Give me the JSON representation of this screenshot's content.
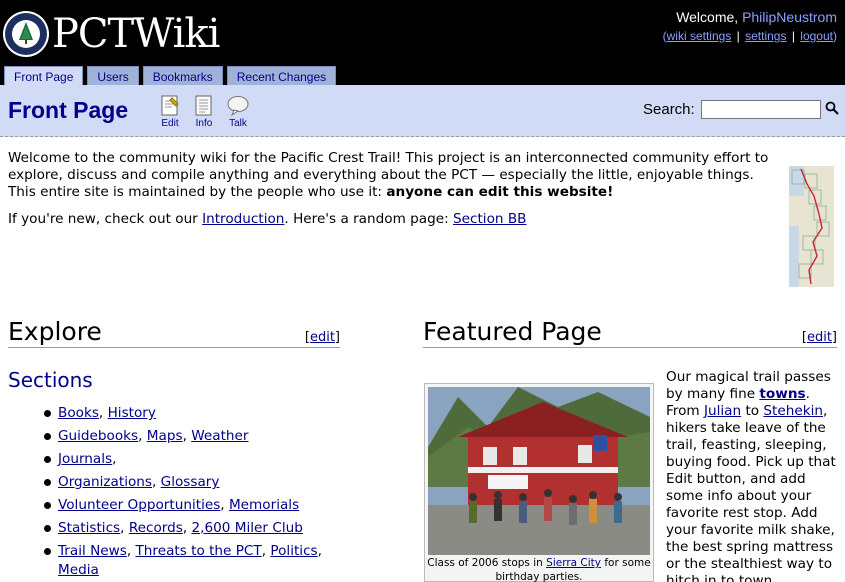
{
  "site": {
    "logo_text": "PCTWiki",
    "badge_text": "Pacific Crest Trail"
  },
  "user": {
    "welcome": "Welcome,",
    "name": "PhilipNeustrom",
    "links": [
      "wiki settings",
      "settings",
      "logout"
    ],
    "open_paren": "(",
    "close_paren": ")",
    "separator": "|"
  },
  "tabs": [
    {
      "label": "Front Page",
      "active": true
    },
    {
      "label": "Users"
    },
    {
      "label": "Bookmarks"
    },
    {
      "label": "Recent Changes"
    }
  ],
  "pagebar": {
    "title": "Front Page",
    "actions": [
      {
        "label": "Edit",
        "icon": "edit-icon"
      },
      {
        "label": "Info",
        "icon": "info-icon"
      },
      {
        "label": "Talk",
        "icon": "talk-icon"
      }
    ],
    "search_label": "Search:",
    "search_value": ""
  },
  "intro": {
    "p1": "Welcome to the community wiki for the Pacific Crest Trail! This project is an interconnected community effort to explore, discuss and compile anything and everything about the PCT — especially the little, enjoyable things. This entire site is maintained by the people who use it: ",
    "p1_bold": "anyone can edit this website!",
    "p2_a": "If you're new, check out our ",
    "p2_link1": "Introduction",
    "p2_b": ". Here's a random page: ",
    "p2_link2": "Section BB"
  },
  "explore": {
    "heading": "Explore",
    "edit": "edit",
    "bracket_open": "[",
    "bracket_close": "]",
    "sections_heading": "Sections",
    "items": [
      {
        "links": [
          "Books",
          "History"
        ]
      },
      {
        "links": [
          "Guidebooks",
          "Maps",
          "Weather"
        ]
      },
      {
        "links": [
          "Journals"
        ],
        "trailing": ","
      },
      {
        "links": [
          "Organizations",
          "Glossary"
        ]
      },
      {
        "links": [
          "Volunteer Opportunities",
          "Memorials"
        ]
      },
      {
        "links": [
          "Statistics",
          "Records",
          "2,600 Miler Club"
        ]
      },
      {
        "links": [
          "Trail News",
          "Threats to the PCT",
          "Politics",
          "Media"
        ]
      }
    ],
    "comma": ", "
  },
  "featured": {
    "heading": "Featured Page",
    "edit": "edit",
    "caption_a": "Class of 2006 stops in ",
    "caption_link": "Sierra City",
    "caption_b": " for some birthday parties.",
    "text_a": "Our magical trail passes by many fine ",
    "text_bold_link": "towns",
    "text_b": ". From ",
    "text_link1": "Julian",
    "text_c": " to ",
    "text_link2": "Stehekin",
    "text_d": ", hikers take leave of the trail, feasting, sleeping, buying food. Pick up that Edit button, and add some info about your favorite rest stop. Add your favorite milk shake, the best spring mattress or the stealthiest way to hitch in to town."
  }
}
